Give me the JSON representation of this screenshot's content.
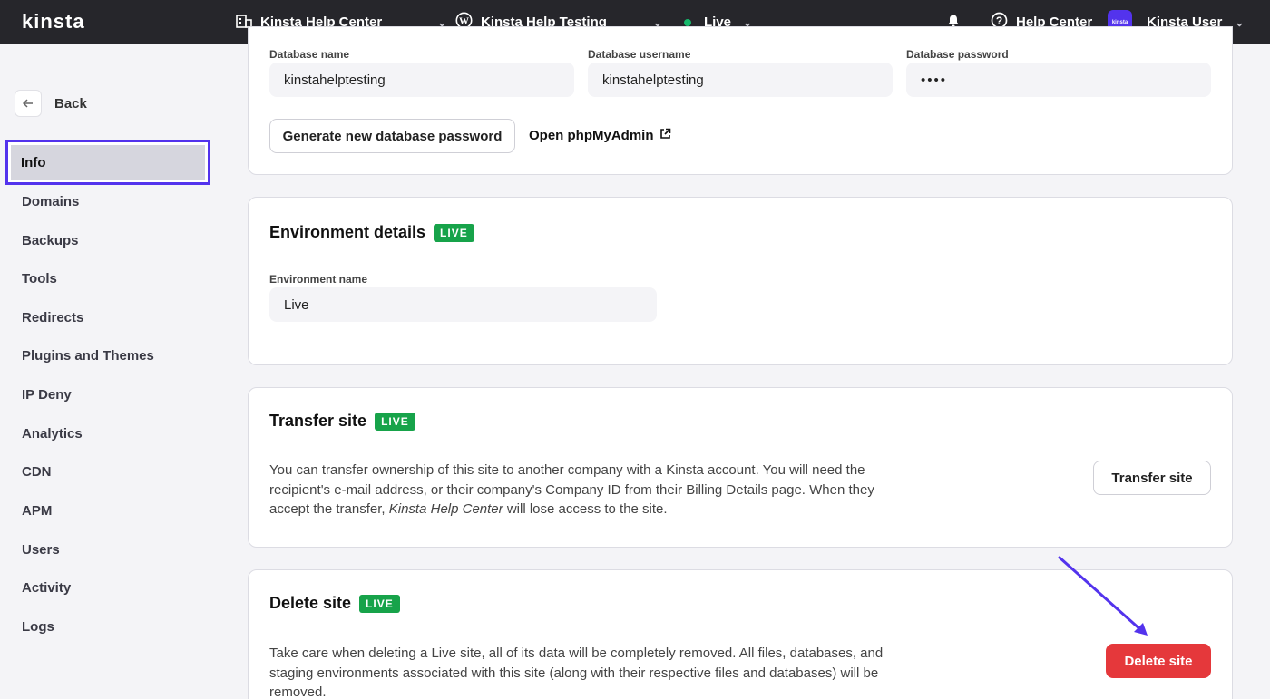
{
  "topbar": {
    "logo": "kinsta",
    "company": "Kinsta Help Center",
    "site": "Kinsta Help Testing",
    "environment": "Live",
    "help": "Help Center",
    "avatar_text": "kinsta",
    "user": "Kinsta User"
  },
  "sidebar": {
    "back": "Back",
    "items": [
      "Info",
      "Domains",
      "Backups",
      "Tools",
      "Redirects",
      "Plugins and Themes",
      "IP Deny",
      "Analytics",
      "CDN",
      "APM",
      "Users",
      "Activity",
      "Logs"
    ]
  },
  "database": {
    "name_label": "Database name",
    "name_value": "kinstahelptesting",
    "user_label": "Database username",
    "user_value": "kinstahelptesting",
    "password_label": "Database password",
    "password_value": "••••",
    "generate_button": "Generate new database password",
    "phpmyadmin_link": "Open phpMyAdmin"
  },
  "environment": {
    "title": "Environment details",
    "badge": "LIVE",
    "name_label": "Environment name",
    "name_value": "Live"
  },
  "transfer": {
    "title": "Transfer site",
    "badge": "LIVE",
    "desc_1": "You can transfer ownership of this site to another company with a Kinsta account. You will need the",
    "desc_2": "recipient's e-mail address, or their company's Company ID from their Billing Details page. When they",
    "desc_3a": "accept the transfer, ",
    "desc_3b": "Kinsta Help Center",
    "desc_3c": " will lose access to the site.",
    "button": "Transfer site"
  },
  "delete": {
    "title": "Delete site",
    "badge": "LIVE",
    "desc_1": "Take care when deleting a Live site, all of its data will be completely removed. All files, databases, and",
    "desc_2": "staging environments associated with this site (along with their respective files and databases) will be",
    "desc_3": "removed.",
    "button": "Delete site"
  },
  "colors": {
    "accent": "#5333ed",
    "live_badge": "#17a34a",
    "danger": "#e5383b",
    "status_dot": "#16b86b"
  }
}
